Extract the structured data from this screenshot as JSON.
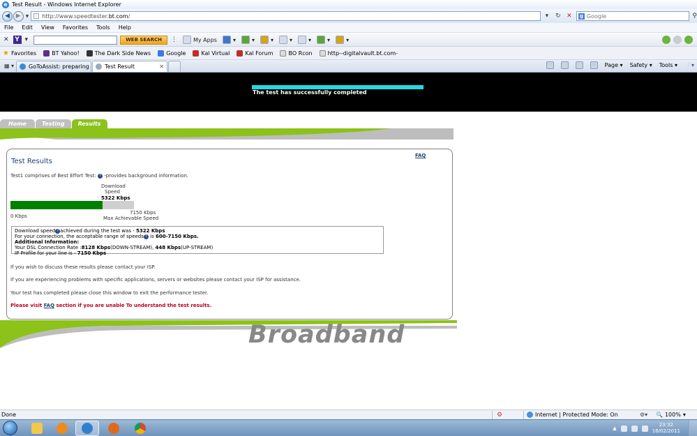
{
  "window": {
    "title": "Test Result - Windows Internet Explorer"
  },
  "address_bar": {
    "url_prefix": "http://www.speedtester.",
    "url_domain": "bt.com",
    "url_suffix": "/",
    "search_placeholder": "Google"
  },
  "menu": [
    "File",
    "Edit",
    "View",
    "Favorites",
    "Tools",
    "Help"
  ],
  "yahoo_toolbar": {
    "search_button": "WEB SEARCH",
    "my_apps": "My Apps"
  },
  "favorites_bar": {
    "favorites_label": "Favorites",
    "items": [
      "BT Yahoo!",
      "The Dark Side News",
      "Google",
      "Kal Virtual",
      "Kal Forum",
      "BO Rcon",
      "http--digitalvault.bt.com-"
    ]
  },
  "tabs": [
    {
      "label": "GoToAssist: preparing to c..."
    },
    {
      "label": "Test Result"
    }
  ],
  "command_bar": [
    "Page",
    "Safety",
    "Tools"
  ],
  "banner": {
    "message": "The test has successfully completed",
    "progress_fraction": 1.0
  },
  "site_nav": [
    "Home",
    "Testing",
    "Results"
  ],
  "results": {
    "faq": "FAQ",
    "title": "Test Results",
    "intro_pre": "Test1 comprises of Best Effort Test:",
    "intro_post": "-provides background information.",
    "download_label_line1": "Download",
    "download_label_line2": "Speed",
    "download_speed": "5322 Kbps",
    "download_speed_kbps": 5322,
    "max_speed_kbps": 7150,
    "min_label": "0 Kbps",
    "max_value_label": "7150 Kbps",
    "max_label": "Max Achievable Speed",
    "info": {
      "line1_pre": "Download speed",
      "line1_mid": "achieved during the test was - ",
      "line1_val": "5322 Kbps",
      "line2_pre": "For your connection, the acceptable range of speeds",
      "line2_mid": " is ",
      "line2_val": "600-7150 Kbps.",
      "line3": "Additional Information:",
      "line4_pre": "Your DSL Connection Rate :",
      "line4_down": "8128 Kbps",
      "line4_down_lbl": "(DOWN-STREAM), ",
      "line4_up": "448 Kbps",
      "line4_up_lbl": "(UP-STREAM)",
      "line5_pre": "IP Profile for your line is - ",
      "line5_val": "7150 Kbps"
    },
    "msg1": "If you wish to discuss these results please contact your ISP.",
    "msg2": "If you are experiencing problems with specific applications, servers or websites please contact your ISP for assistance.",
    "msg3": "Your test has completed please close this window to exit the performance tester.",
    "msg4_pre": "Please visit ",
    "msg4_link": "FAQ",
    "msg4_post": " section if you are unable To understand the test results."
  },
  "logo_text": "Broadband",
  "status_bar": {
    "status": "Done",
    "zone": "Internet | Protected Mode: On",
    "zoom": "100%"
  },
  "taskbar": {
    "time": "23:32",
    "date": "16/02/2011"
  }
}
